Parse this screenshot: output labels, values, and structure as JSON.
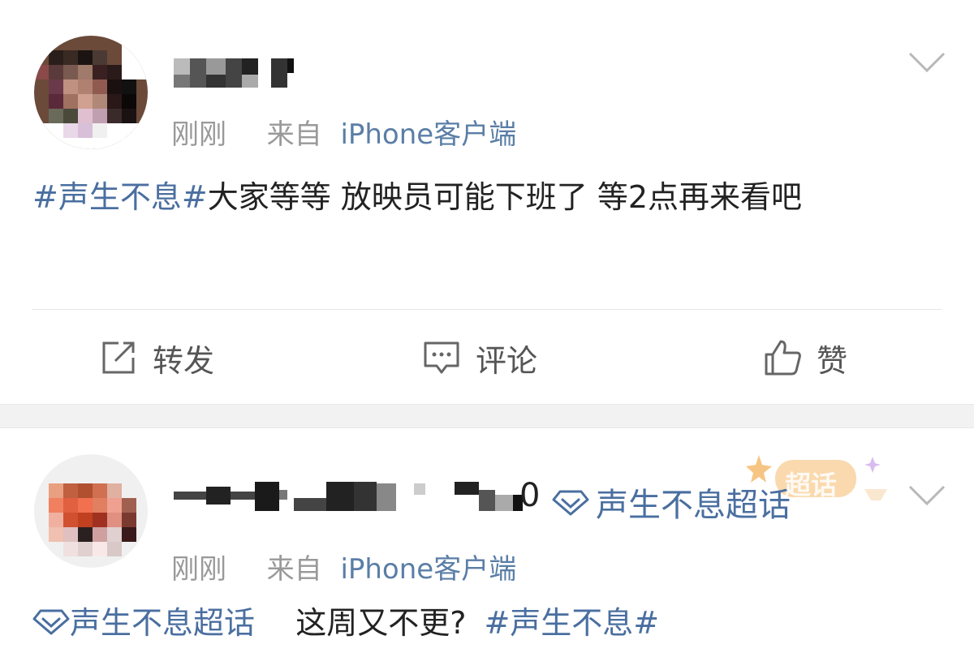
{
  "posts": [
    {
      "time": "刚刚",
      "from_label": "来自",
      "source": "iPhone客户端",
      "content_tag": "#声生不息#",
      "content_text": "大家等等 放映员可能下班了 等2点再来看吧"
    },
    {
      "username_suffix": "0",
      "topic": "声生不息超话",
      "badge_text": "超话",
      "time": "刚刚",
      "from_label": "来自",
      "source": "iPhone客户端",
      "content_topic": "声生不息超话",
      "content_text": "这周又不更?",
      "content_tag": "#声生不息#"
    }
  ],
  "actions": {
    "repost": "转发",
    "comment": "评论",
    "like": "赞"
  },
  "colors": {
    "link": "#4a6fa0",
    "meta": "#999999",
    "separator": "#f2f2f2"
  },
  "icons": [
    "chevron-down-icon",
    "repost-icon",
    "comment-icon",
    "like-icon",
    "supertopic-icon"
  ]
}
